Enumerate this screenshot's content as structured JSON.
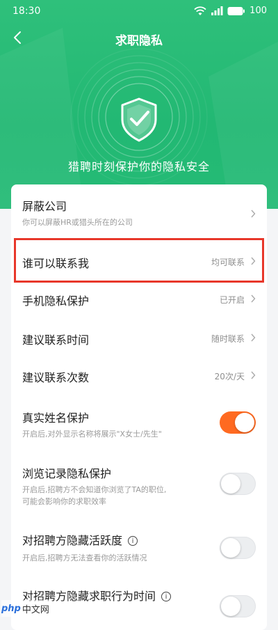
{
  "status_bar": {
    "time": "18:30",
    "battery": "100"
  },
  "nav": {
    "title": "求职隐私"
  },
  "hero": {
    "caption": "猎聘时刻保护你的隐私安全"
  },
  "colors": {
    "brand_green": "#22b873",
    "toggle_on": "#ff6a21",
    "highlight_red": "#e8372a"
  },
  "settings": {
    "block_company": {
      "title": "屏蔽公司",
      "subtitle": "你可以屏蔽HR或猎头所在的公司"
    },
    "who_can_contact": {
      "title": "谁可以联系我",
      "value": "均可联系"
    },
    "phone_privacy": {
      "title": "手机隐私保护",
      "value": "已开启"
    },
    "contact_time": {
      "title": "建议联系时间",
      "value": "随时联系"
    },
    "contact_count": {
      "title": "建议联系次数",
      "value": "20次/天"
    },
    "real_name": {
      "title": "真实姓名保护",
      "subtitle": "开启后,对外显示名称将展示\"X女士/先生\"",
      "enabled": true
    },
    "browse_record": {
      "title": "浏览记录隐私保护",
      "subtitle_line1": "开启后,招聘方不会知道你浏览了TA的职位,",
      "subtitle_line2": "可能会影响你的求职效率",
      "enabled": false
    },
    "hide_activity": {
      "title": "对招聘方隐藏活跃度",
      "subtitle": "开启后,招聘方无法查看你的活跃情况",
      "enabled": false
    },
    "hide_behavior_time": {
      "title": "对招聘方隐藏求职行为时间",
      "enabled": false
    }
  },
  "watermark": {
    "logo": "php",
    "text": "中文网"
  }
}
